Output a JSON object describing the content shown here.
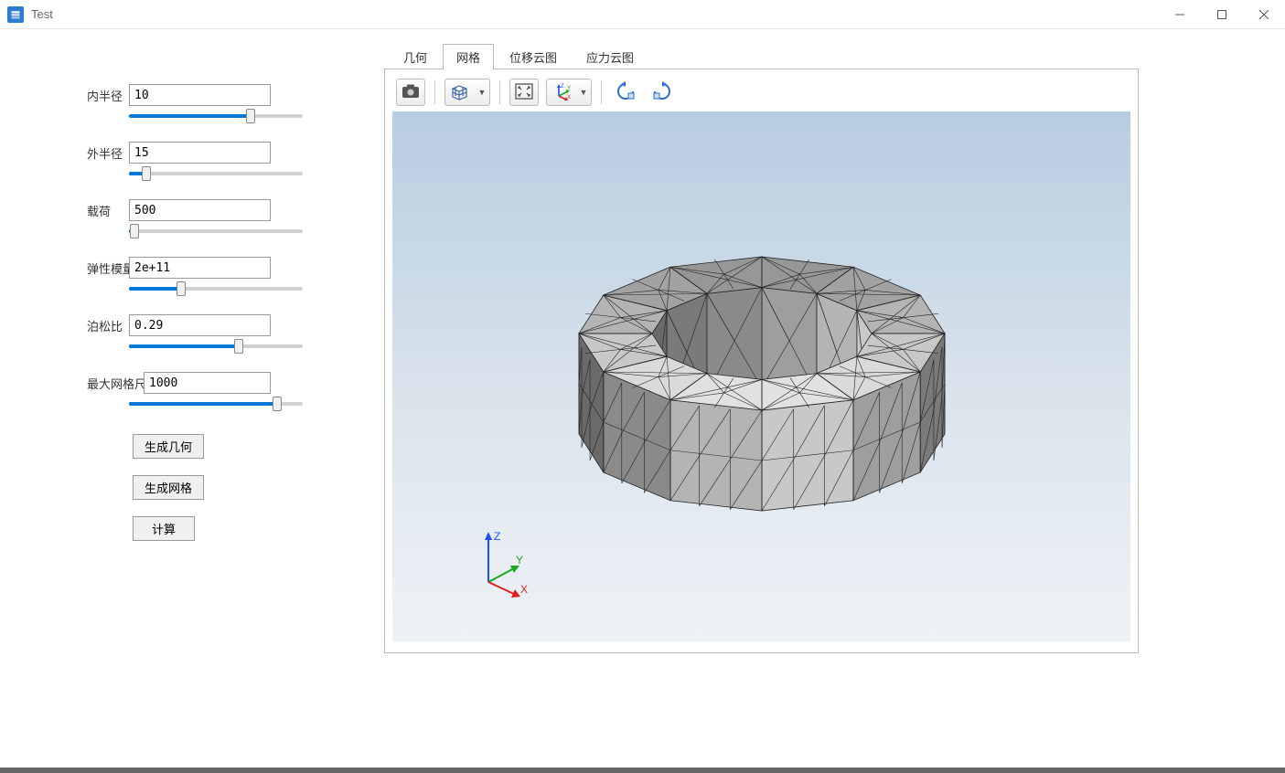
{
  "window": {
    "title": "Test"
  },
  "params": {
    "inner_radius": {
      "label": "内半径",
      "value": "10",
      "slider_pct": 70
    },
    "outer_radius": {
      "label": "外半径",
      "value": "15",
      "slider_pct": 10
    },
    "load": {
      "label": "载荷",
      "value": "500",
      "slider_pct": 3
    },
    "youngs_mod": {
      "label": "弹性模量",
      "value": "2e+11",
      "slider_pct": 30
    },
    "poisson": {
      "label": "泊松比",
      "value": "0.29",
      "slider_pct": 63
    },
    "max_mesh": {
      "label": "最大网格尺寸",
      "value": "1000",
      "slider_pct": 85
    }
  },
  "buttons": {
    "gen_geometry": "生成几何",
    "gen_mesh": "生成网格",
    "compute": "计算"
  },
  "tabs": {
    "geometry": "几何",
    "mesh": "网格",
    "displacement": "位移云图",
    "stress": "应力云图",
    "active": "mesh"
  },
  "axes": {
    "x": "X",
    "y": "Y",
    "z": "Z"
  },
  "toolbar_axes": {
    "x": "X",
    "y": "Y",
    "z": "Z"
  }
}
